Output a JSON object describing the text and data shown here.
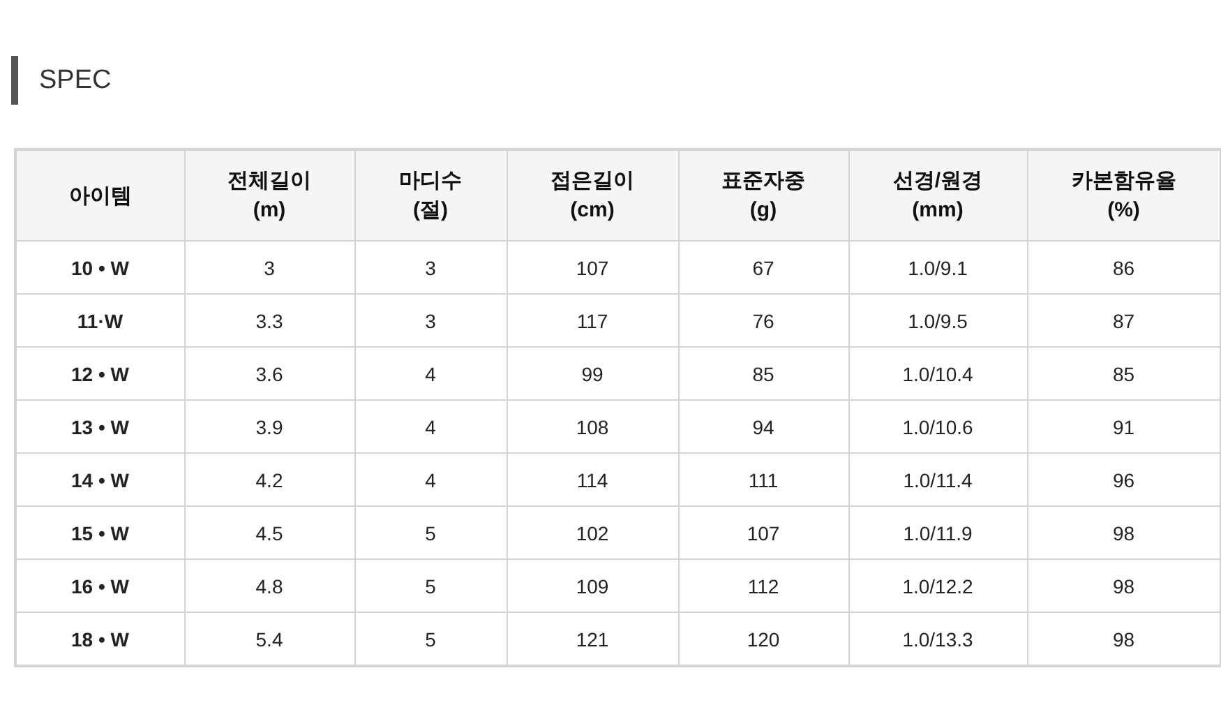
{
  "title": "SPEC",
  "table": {
    "columns": [
      "아이템",
      "전체길이\n(m)",
      "마디수\n(절)",
      "접은길이\n(cm)",
      "표준자중\n(g)",
      "선경/원경\n(mm)",
      "카본함유율\n(%)"
    ],
    "rows": [
      [
        "10 • W",
        "3",
        "3",
        "107",
        "67",
        "1.0/9.1",
        "86"
      ],
      [
        "11·W",
        "3.3",
        "3",
        "117",
        "76",
        "1.0/9.5",
        "87"
      ],
      [
        "12 • W",
        "3.6",
        "4",
        "99",
        "85",
        "1.0/10.4",
        "85"
      ],
      [
        "13 • W",
        "3.9",
        "4",
        "108",
        "94",
        "1.0/10.6",
        "91"
      ],
      [
        "14 • W",
        "4.2",
        "4",
        "114",
        "111",
        "1.0/11.4",
        "96"
      ],
      [
        "15 • W",
        "4.5",
        "5",
        "102",
        "107",
        "1.0/11.9",
        "98"
      ],
      [
        "16 • W",
        "4.8",
        "5",
        "109",
        "112",
        "1.0/12.2",
        "98"
      ],
      [
        "18 • W",
        "5.4",
        "5",
        "121",
        "120",
        "1.0/13.3",
        "98"
      ]
    ]
  }
}
